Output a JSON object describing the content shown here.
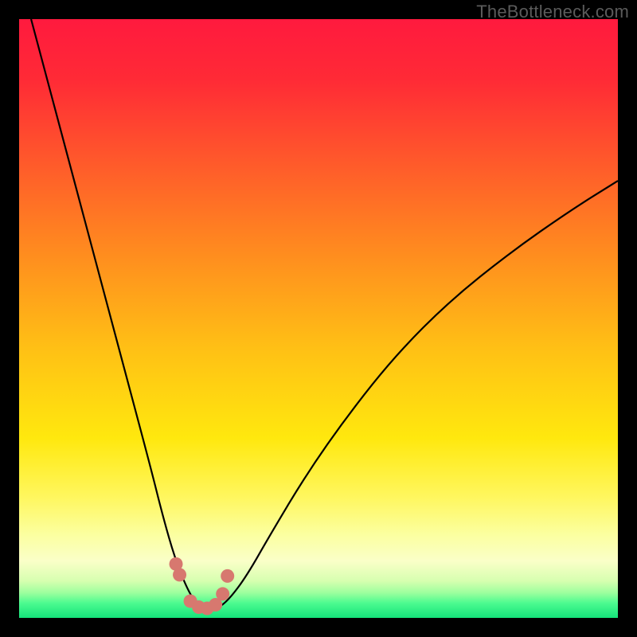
{
  "watermark": "TheBottleneck.com",
  "colors": {
    "background": "#000000",
    "curve": "#000000",
    "marker": "#d7786f",
    "gradient_stops": [
      {
        "offset": 0.0,
        "color": "#ff1a3e"
      },
      {
        "offset": 0.1,
        "color": "#ff2a36"
      },
      {
        "offset": 0.25,
        "color": "#ff5d2a"
      },
      {
        "offset": 0.4,
        "color": "#ff8f1e"
      },
      {
        "offset": 0.55,
        "color": "#ffc015"
      },
      {
        "offset": 0.7,
        "color": "#ffe80e"
      },
      {
        "offset": 0.8,
        "color": "#fff760"
      },
      {
        "offset": 0.86,
        "color": "#fbff9f"
      },
      {
        "offset": 0.905,
        "color": "#faffc8"
      },
      {
        "offset": 0.938,
        "color": "#d7ffb0"
      },
      {
        "offset": 0.958,
        "color": "#9dff9e"
      },
      {
        "offset": 0.975,
        "color": "#4dfb90"
      },
      {
        "offset": 1.0,
        "color": "#14e37a"
      }
    ]
  },
  "chart_data": {
    "type": "line",
    "title": "",
    "xlabel": "",
    "ylabel": "",
    "xlim": [
      0,
      100
    ],
    "ylim": [
      0,
      100
    ],
    "series": [
      {
        "name": "bottleneck-curve",
        "x": [
          2,
          6,
          10,
          14,
          18,
          22,
          24,
          26,
          28,
          29.5,
          31,
          33,
          35,
          38,
          42,
          48,
          55,
          63,
          72,
          82,
          92,
          100
        ],
        "y": [
          100,
          85,
          70,
          55,
          40,
          25,
          17,
          10,
          5,
          2.5,
          1.5,
          1.5,
          3,
          7,
          14,
          24,
          34,
          44,
          53,
          61,
          68,
          73
        ]
      }
    ],
    "markers": {
      "name": "highlight-points",
      "x": [
        26.2,
        26.8,
        28.6,
        30.0,
        31.4,
        32.8,
        34.0,
        34.8
      ],
      "y": [
        9.0,
        7.2,
        2.8,
        1.8,
        1.6,
        2.2,
        4.0,
        7.0
      ]
    }
  }
}
